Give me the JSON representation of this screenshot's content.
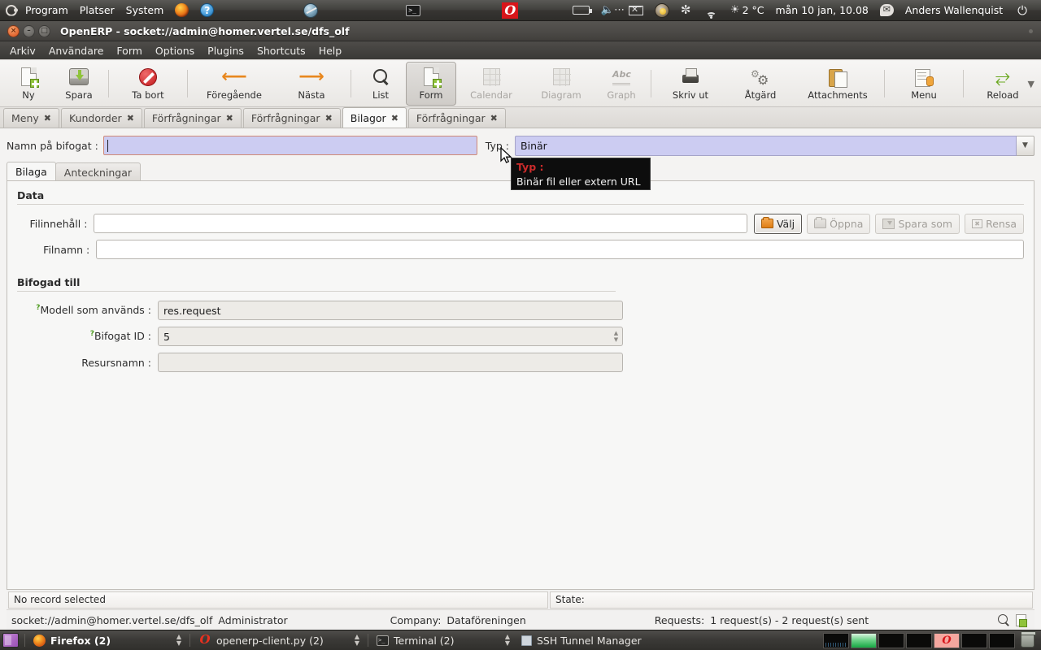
{
  "gnome_panel": {
    "apps_menu": [
      "Program",
      "Platser",
      "System"
    ],
    "launchers": [
      "firefox-icon",
      "help-icon",
      "globe-icon",
      "terminal-icon",
      "opera-icon"
    ],
    "tray": {
      "battery": "battery-icon",
      "volume": "volume-icon",
      "mail": "mail-icon",
      "avatar": "user-avatar-icon",
      "fan": "fan-icon",
      "wifi": "wifi-icon",
      "weather_icon": "weather-icon",
      "temperature": "2 °C",
      "clock": "mån 10 jan, 10.08",
      "messaging": "messaging-icon",
      "user": "Anders Wallenquist",
      "power": "power-icon"
    }
  },
  "window": {
    "title": "OpenERP - socket://admin@homer.vertel.se/dfs_olf",
    "buttons": {
      "close": "×",
      "minimize": "–",
      "maximize": "□"
    }
  },
  "menubar": [
    "Arkiv",
    "Användare",
    "Form",
    "Options",
    "Plugins",
    "Shortcuts",
    "Help"
  ],
  "toolbar": {
    "items": [
      {
        "label": "Ny",
        "icon": "new-document-icon",
        "state": "enabled"
      },
      {
        "label": "Spara",
        "icon": "save-disk-icon",
        "state": "enabled"
      },
      {
        "label": "Ta bort",
        "icon": "delete-icon",
        "state": "enabled"
      },
      {
        "label": "Föregående",
        "icon": "arrow-left-icon",
        "state": "enabled"
      },
      {
        "label": "Nästa",
        "icon": "arrow-right-icon",
        "state": "enabled"
      },
      {
        "label": "List",
        "icon": "magnifier-icon",
        "state": "enabled"
      },
      {
        "label": "Form",
        "icon": "form-icon",
        "state": "active"
      },
      {
        "label": "Calendar",
        "icon": "calendar-icon",
        "state": "disabled"
      },
      {
        "label": "Diagram",
        "icon": "diagram-icon",
        "state": "disabled"
      },
      {
        "label": "Graph",
        "icon": "graph-icon",
        "state": "disabled"
      },
      {
        "label": "Skriv ut",
        "icon": "printer-icon",
        "state": "enabled"
      },
      {
        "label": "Åtgärd",
        "icon": "gears-icon",
        "state": "enabled"
      },
      {
        "label": "Attachments",
        "icon": "clipboard-icon",
        "state": "enabled"
      },
      {
        "label": "Menu",
        "icon": "menu-icon",
        "state": "enabled"
      },
      {
        "label": "Reload",
        "icon": "reload-icon",
        "state": "enabled"
      }
    ],
    "overflow": "▼"
  },
  "tabs": [
    {
      "label": "Meny",
      "active": false
    },
    {
      "label": "Kundorder",
      "active": false
    },
    {
      "label": "Förfrågningar",
      "active": false
    },
    {
      "label": "Förfrågningar",
      "active": false
    },
    {
      "label": "Bilagor",
      "active": true
    },
    {
      "label": "Förfrågningar",
      "active": false
    }
  ],
  "form": {
    "name_label": "Namn på bifogat :",
    "name_value": "",
    "type_label": "Typ :",
    "type_value": "Binär",
    "inner_tabs": [
      {
        "label": "Bilaga",
        "active": true
      },
      {
        "label": "Anteckningar",
        "active": false
      }
    ],
    "group_data": {
      "title": "Data",
      "rows": [
        {
          "label": "Filinnehåll :",
          "value": ""
        },
        {
          "label": "Filnamn :",
          "value": ""
        }
      ],
      "buttons": [
        {
          "label": "Välj",
          "icon": "folder-open-icon",
          "state": "enabled"
        },
        {
          "label": "Öppna",
          "icon": "folder-icon",
          "state": "disabled"
        },
        {
          "label": "Spara som",
          "icon": "save-as-icon",
          "state": "disabled"
        },
        {
          "label": "Rensa",
          "icon": "clear-icon",
          "state": "disabled"
        }
      ]
    },
    "group_attached": {
      "title": "Bifogad till",
      "rows": [
        {
          "help": "?",
          "label": "Modell som används :",
          "value": "res.request",
          "kind": "text"
        },
        {
          "help": "?",
          "label": "Bifogat ID :",
          "value": "5",
          "kind": "spinner"
        },
        {
          "help": "",
          "label": "Resursnamn :",
          "value": "",
          "kind": "readonly"
        }
      ]
    }
  },
  "tooltip": {
    "title": "Typ :",
    "body": "Binär fil eller extern URL"
  },
  "statusbar": {
    "record": "No record selected",
    "state_label": "State:",
    "state_value": ""
  },
  "footer": {
    "connection": "socket://admin@homer.vertel.se/dfs_olf",
    "user": "Administrator",
    "company_label": "Company:",
    "company_value": "Dataföreningen",
    "requests_label": "Requests:",
    "requests_value": "1 request(s) - 2 request(s) sent",
    "icons": [
      "magnifier-icon",
      "new-request-icon"
    ]
  },
  "taskbar": {
    "show_desktop": "show-desktop-icon",
    "tasks": [
      {
        "label": "Firefox (2)",
        "icon": "firefox-icon",
        "focused": true
      },
      {
        "label": "openerp-client.py (2)",
        "icon": "opera-icon",
        "focused": false
      },
      {
        "label": "Terminal (2)",
        "icon": "terminal-icon",
        "focused": false
      },
      {
        "label": "SSH Tunnel Manager",
        "icon": "window-icon",
        "focused": false
      }
    ],
    "workspaces": [
      "ws-dark",
      "ws-green",
      "ws-dark",
      "ws-dark",
      "ws-opera",
      "ws-dark",
      "ws-dark"
    ],
    "trash": "trash-icon"
  },
  "colors": {
    "accent_orange": "#e8871e",
    "field_lavender": "#ccccf2",
    "focus_border": "#d08a78",
    "green": "#8fc33a",
    "tooltip_title": "#cc2b2b",
    "panel_dark": "#3a3936"
  }
}
